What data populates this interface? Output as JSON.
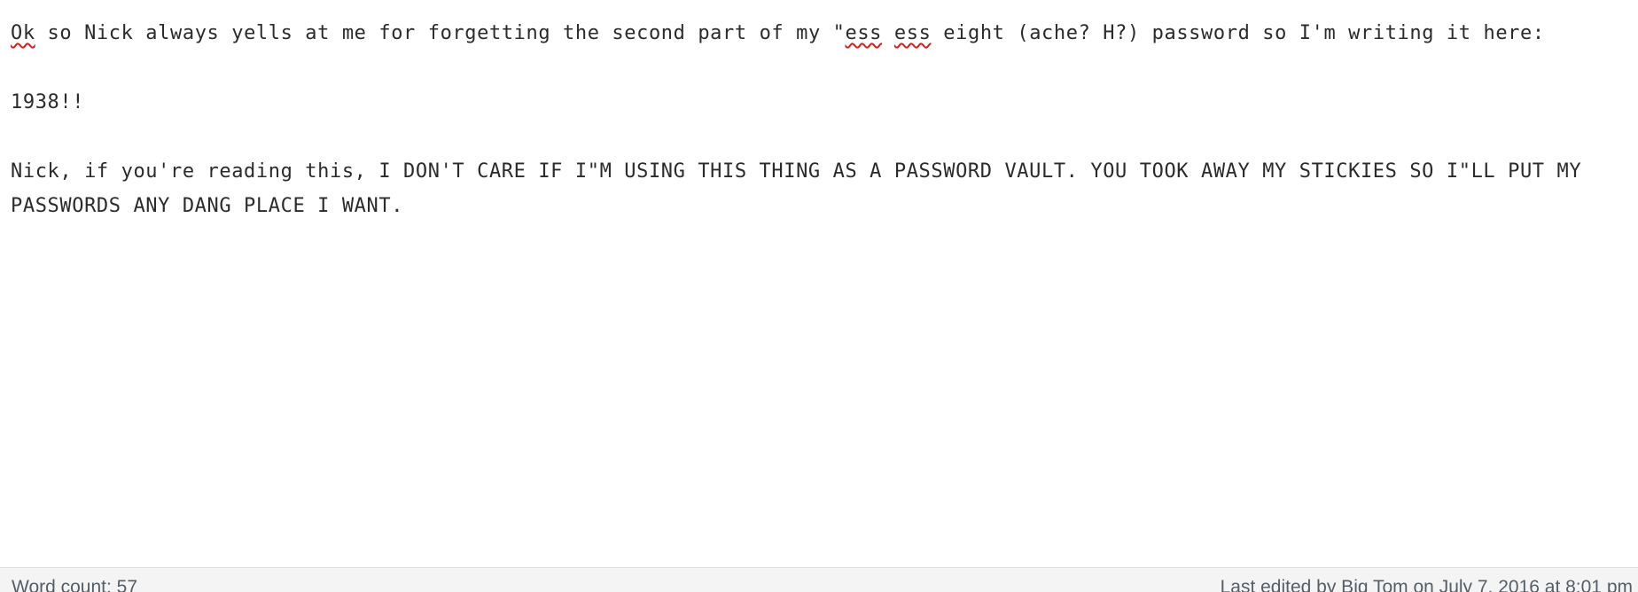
{
  "editor": {
    "paragraph1": {
      "part_ok": "Ok",
      "part_a": " so Nick always yells at me for forgetting the second part of my \"",
      "part_ess1": "ess",
      "part_space": " ",
      "part_ess2": "ess",
      "part_b": " eight (ache? H?) password so I'm writing it here:"
    },
    "paragraph2": "1938!!",
    "paragraph3": "Nick, if you're reading this, I DON'T CARE IF I\"M USING THIS THING AS A PASSWORD VAULT. YOU TOOK AWAY MY STICKIES SO I\"LL PUT MY PASSWORDS ANY DANG PLACE I WANT."
  },
  "statusbar": {
    "word_count": "Word count: 57",
    "last_edited": "Last edited by Big Tom on July 7, 2016 at 8:01 pm"
  },
  "colors": {
    "spellcheck_underline": "#d42020",
    "statusbar_bg": "#f4f4f4"
  }
}
